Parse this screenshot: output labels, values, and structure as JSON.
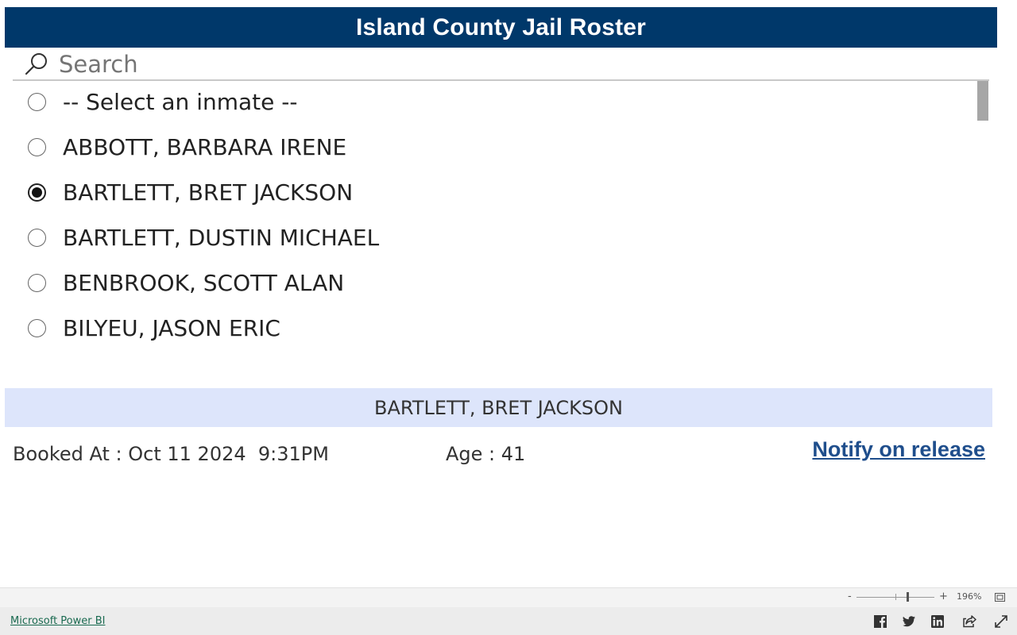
{
  "header": {
    "title": "Island County Jail Roster"
  },
  "search": {
    "placeholder": "Search",
    "value": ""
  },
  "inmate_list": {
    "items": [
      {
        "label": "-- Select an inmate --",
        "selected": false
      },
      {
        "label": "ABBOTT, BARBARA IRENE",
        "selected": false
      },
      {
        "label": "BARTLETT, BRET JACKSON",
        "selected": true
      },
      {
        "label": "BARTLETT, DUSTIN MICHAEL",
        "selected": false
      },
      {
        "label": "BENBROOK, SCOTT ALAN",
        "selected": false
      },
      {
        "label": "BILYEU, JASON ERIC",
        "selected": false
      }
    ]
  },
  "details": {
    "selected_name": "BARTLETT, BRET JACKSON",
    "booked_at": "Booked At : Oct 11 2024  9:31PM",
    "age": "Age : 41",
    "notify_label": "Notify on release"
  },
  "zoom": {
    "minus": "-",
    "plus": "+",
    "level": "196%",
    "level_fraction": 0.66
  },
  "footer": {
    "brand_link": "Microsoft Power BI",
    "icons": [
      "facebook-icon",
      "twitter-icon",
      "linkedin-icon",
      "share-icon",
      "fullscreen-icon"
    ]
  },
  "colors": {
    "header_bg": "#00386a",
    "selected_bar_bg": "#dde5fb",
    "link": "#1f4e8c",
    "footer_link": "#1a6a50"
  }
}
